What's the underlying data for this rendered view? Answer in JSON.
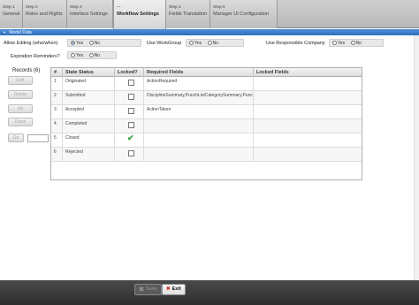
{
  "tabs": [
    {
      "step": "Step 1",
      "name": "General"
    },
    {
      "step": "Step 2",
      "name": "Roles and Rights"
    },
    {
      "step": "Step 3",
      "name": "Interface Settings"
    },
    {
      "step": "—",
      "name": "Workflow Settings"
    },
    {
      "step": "Step 4",
      "name": "Fields Translation"
    },
    {
      "step": "Step 5",
      "name": "Manager UI Configuration"
    }
  ],
  "panel": {
    "title": "Model Data"
  },
  "settings": {
    "allow_editing": {
      "label": "Allow Editing (who/when)",
      "yes": "Yes",
      "no": "No",
      "selected": "Yes"
    },
    "use_workgroup": {
      "label": "Use WorkGroup",
      "yes": "Yes",
      "no": "No"
    },
    "use_responsible_company": {
      "label": "Use Responsible Company",
      "yes": "Yes",
      "no": "No"
    },
    "expiration_reminders": {
      "label": "Expiration Reminders?",
      "yes": "Yes",
      "no": "No"
    }
  },
  "records": {
    "label": "Records (6)",
    "buttons": [
      "Edit",
      "Delete",
      "Up",
      "Down"
    ],
    "goto_label": "Go"
  },
  "table": {
    "columns": [
      "#",
      "State Status",
      "Locked?",
      "Required Fields",
      "Locked Fields"
    ],
    "rows": [
      {
        "num": "1",
        "status": "Originated",
        "locked": false,
        "required": "ActionRequired",
        "locked_fields": ""
      },
      {
        "num": "2",
        "status": "Submitted",
        "locked": false,
        "required": "DisciplineSummary,PunchListCategorySummary,Punc",
        "locked_fields": ""
      },
      {
        "num": "3",
        "status": "Accepted",
        "locked": false,
        "required": "ActionTaken",
        "locked_fields": ""
      },
      {
        "num": "4",
        "status": "Completed",
        "locked": false,
        "required": "",
        "locked_fields": ""
      },
      {
        "num": "5",
        "status": "Closed",
        "locked": true,
        "required": "",
        "locked_fields": ""
      },
      {
        "num": "6",
        "status": "Rejected",
        "locked": false,
        "required": "",
        "locked_fields": ""
      }
    ]
  },
  "footer": {
    "save": "Save",
    "exit": "Exit"
  },
  "colors": {
    "accent": "#2f6fbd",
    "locked_check": "#2e9e2e",
    "exit_icon": "#dd2222"
  }
}
